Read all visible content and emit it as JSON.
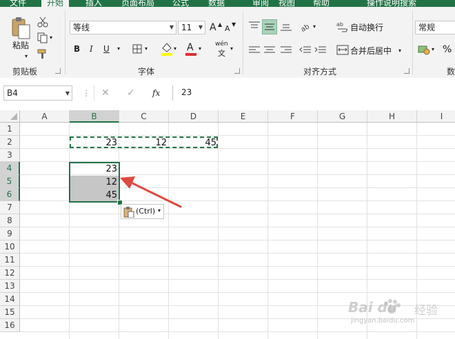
{
  "ribbon_tabs": [
    "文件",
    "开始",
    "插入",
    "页面布局",
    "公式",
    "数据",
    "审阅",
    "视图",
    "帮助",
    "操作说明搜索"
  ],
  "clipboard": {
    "paste_label": "粘贴",
    "group_label": "剪贴板"
  },
  "font": {
    "name": "等线",
    "size": "11",
    "grow": "A",
    "shrink": "A",
    "bold": "B",
    "italic": "I",
    "underline": "U",
    "phonetic": "wén",
    "group_label": "字体"
  },
  "alignment": {
    "wrap_text": "自动换行",
    "merge_center": "合并后居中",
    "group_label": "对齐方式"
  },
  "number": {
    "format": "常规",
    "percent": "%",
    "group_label": "数"
  },
  "formula_bar": {
    "name_box": "B4",
    "fx": "fx",
    "value": "23"
  },
  "sheet": {
    "columns": [
      "A",
      "B",
      "C",
      "D",
      "E",
      "F",
      "G",
      "H",
      "I"
    ],
    "rows": [
      "1",
      "2",
      "3",
      "4",
      "5",
      "6",
      "7",
      "8",
      "9",
      "10",
      "11",
      "12",
      "13",
      "14",
      "15",
      "16"
    ],
    "row2": {
      "b": "23",
      "c": "12",
      "d": "45"
    },
    "copied": [
      "23",
      "12",
      "45"
    ],
    "selected_column": "B",
    "selected_rows": [
      "4",
      "5",
      "6"
    ]
  },
  "paste_options": {
    "label": "(Ctrl)"
  },
  "watermark": {
    "brand": "Bai du",
    "sub": "经验",
    "url": "jingyan.baidu.com"
  },
  "colors": {
    "excel_green": "#217346",
    "selection_fill": "#c6c6c6",
    "arrow_red": "#e2483f"
  }
}
